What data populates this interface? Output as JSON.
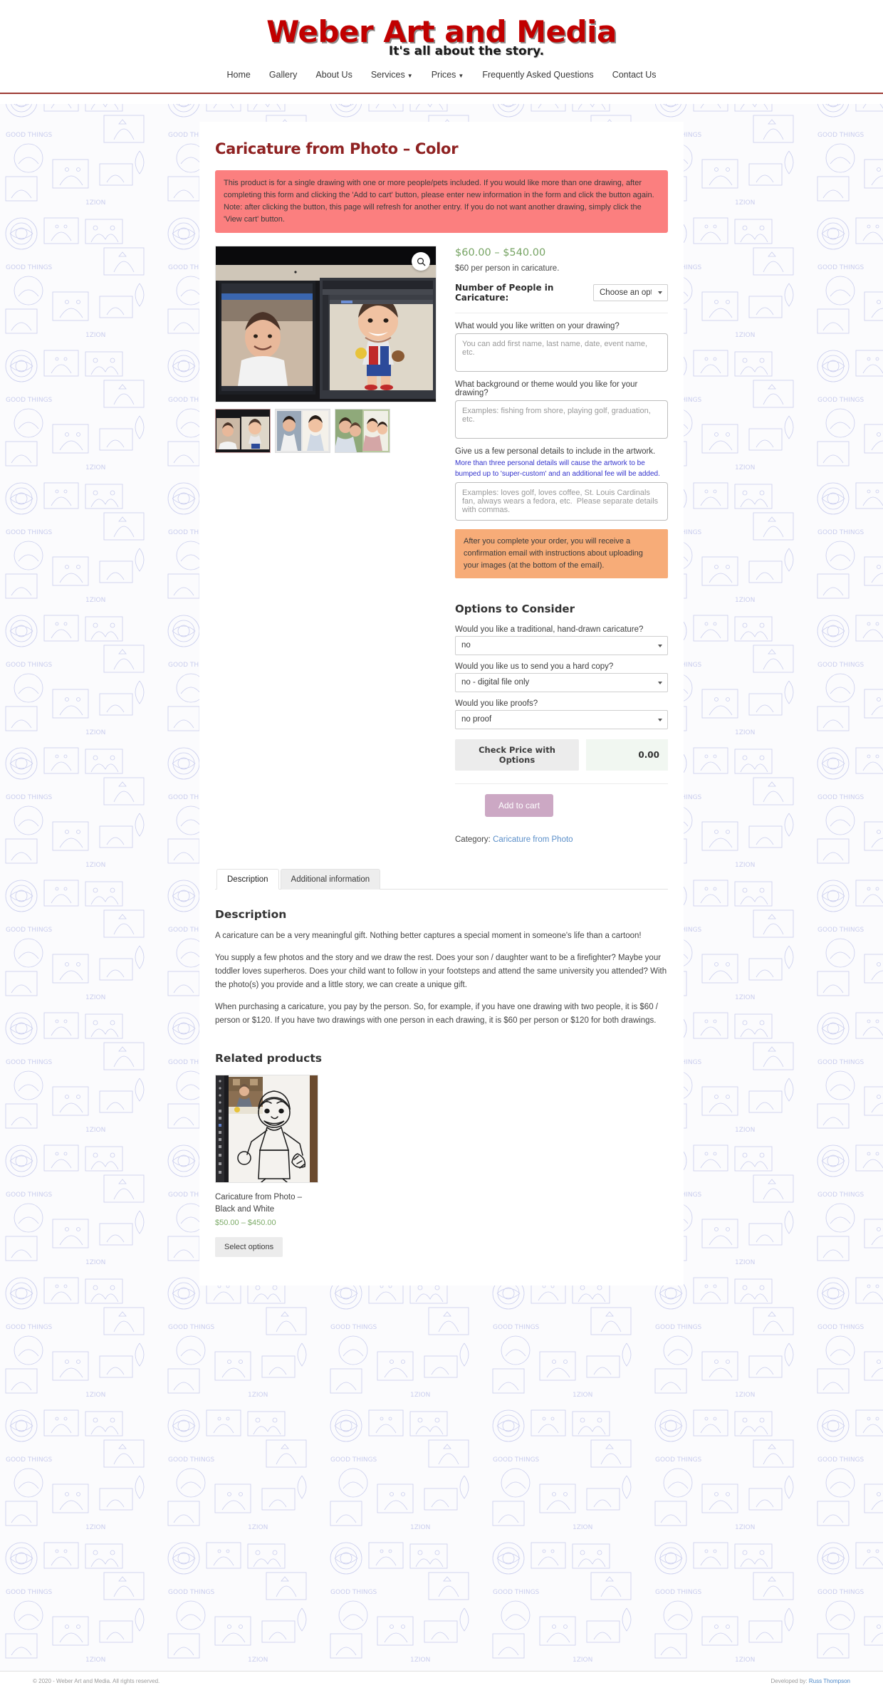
{
  "header": {
    "brand_title": "Weber Art and Media",
    "tagline": "It's all about the story.",
    "nav": [
      {
        "label": "Home",
        "has_caret": false
      },
      {
        "label": "Gallery",
        "has_caret": false
      },
      {
        "label": "About Us",
        "has_caret": false
      },
      {
        "label": "Services",
        "has_caret": true
      },
      {
        "label": "Prices",
        "has_caret": true
      },
      {
        "label": "Frequently Asked Questions",
        "has_caret": false
      },
      {
        "label": "Contact Us",
        "has_caret": false
      }
    ]
  },
  "product": {
    "title": "Caricature from Photo – Color",
    "alert_red": "This product is for a single drawing with one or more people/pets included. If you would like more than one drawing, after completing this form and clicking the 'Add to cart' button, please enter new information in the form and click the button again. Note: after clicking the button, this page will refresh for another entry. If you do not want another drawing, simply click the 'View cart' button.",
    "price_range": "$60.00 – $540.00",
    "price_note": "$60 per person in caricature.",
    "people_label": "Number of People in Caricature:",
    "people_selected": "Choose an option",
    "zoom_icon": "search-icon",
    "fields": [
      {
        "label": "What would you like written on your drawing?",
        "placeholder": "You can add first name, last name, date, event name, etc.",
        "value": ""
      },
      {
        "label": "What background or theme would you like for your drawing?",
        "placeholder": "Examples: fishing from shore, playing golf, graduation, etc.",
        "value": ""
      },
      {
        "label": "Give us a few personal details to include in the artwork.",
        "sublabel": "More than three personal details will cause the artwork to be bumped up to 'super-custom' and an additional fee will be added.",
        "placeholder": "Examples: loves golf, loves coffee, St. Louis Cardinals fan, always wears a fedora, etc.  Please separate details with commas.",
        "value": ""
      }
    ],
    "alert_orange": "After you complete your order, you will receive a confirmation email with instructions about uploading your images (at the bottom of the email).",
    "options_heading": "Options to Consider",
    "options": [
      {
        "label": "Would you like a traditional, hand-drawn caricature?",
        "selected": "no"
      },
      {
        "label": "Would you like us to send you a hard copy?",
        "selected": "no - digital file only"
      },
      {
        "label": "Would you like proofs?",
        "selected": "no proof"
      }
    ],
    "check_price_label": "Check Price with Options",
    "computed_price": "0.00",
    "add_to_cart_label": "Add to cart",
    "category_prefix": "Category:",
    "category_link": "Caricature from Photo"
  },
  "tabs": [
    {
      "label": "Description",
      "active": true
    },
    {
      "label": "Additional information",
      "active": false
    }
  ],
  "description": {
    "heading": "Description",
    "paragraphs": [
      "A caricature can be a very meaningful gift.  Nothing better captures a special moment in someone's life than a cartoon!",
      "You supply a few photos and the story and we draw the rest. Does your son / daughter want to be a firefighter? Maybe your toddler loves superheros. Does your child want to follow in your footsteps and attend the same university you attended? With the photo(s) you provide and a little story, we can create a unique gift.",
      "When purchasing a caricature, you pay by the person.  So, for example, if you have one drawing with two people, it is $60 / person or $120.  If you have two drawings with one person in each drawing, it is $60 per person or $120 for both drawings."
    ]
  },
  "related": {
    "heading": "Related products",
    "items": [
      {
        "name": "Caricature from Photo – Black and White",
        "price": "$50.00 – $450.00",
        "button_label": "Select options"
      }
    ]
  },
  "footer": {
    "copyright": "© 2020 - Weber Art and Media. All rights reserved.",
    "developed_prefix": "Developed by:",
    "developer": "Russ Thompson"
  },
  "colors": {
    "brand_red": "#c10000",
    "title_maroon": "#8f2222",
    "alert_red_bg": "#fb7f7f",
    "alert_orange_bg": "#f7ac78",
    "price_green": "#77a464",
    "cart_purple": "#cca8c4",
    "link_blue": "#5b8fc9",
    "sublabel_blue": "#3333cc"
  }
}
